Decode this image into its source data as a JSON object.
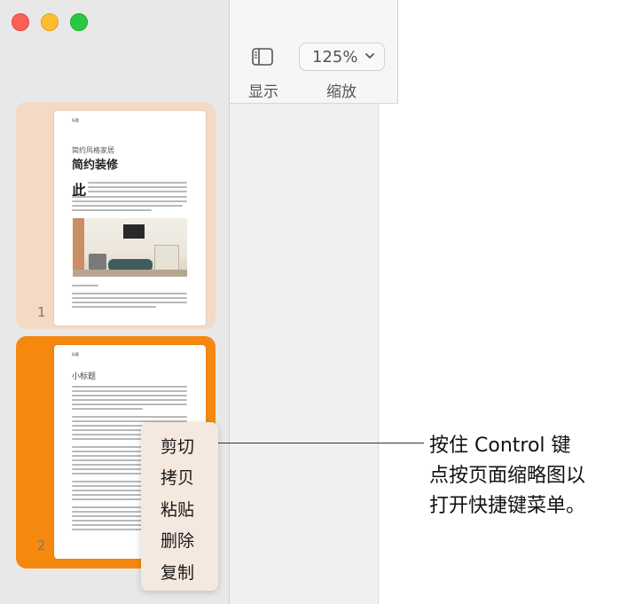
{
  "toolbar": {
    "view_label": "显示",
    "zoom_value": "125%",
    "zoom_label": "缩放"
  },
  "thumbnails": [
    {
      "number": "1",
      "header": "标题",
      "subtitle": "简约风格家居",
      "title": "简约装修",
      "dropcap": "此"
    },
    {
      "number": "2",
      "header": "标题",
      "heading": "小标题"
    }
  ],
  "context_menu": {
    "items": [
      "剪切",
      "拷贝",
      "粘贴",
      "删除",
      "复制"
    ]
  },
  "callout": {
    "lines": [
      "按住 Control 键",
      "点按页面缩略图以",
      "打开快捷键菜单。"
    ]
  }
}
